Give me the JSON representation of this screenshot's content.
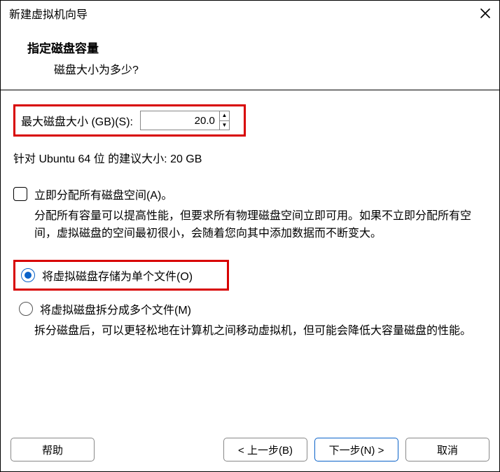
{
  "window": {
    "title": "新建虚拟机向导"
  },
  "header": {
    "title": "指定磁盘容量",
    "subtitle": "磁盘大小为多少?"
  },
  "disk": {
    "size_label": "最大磁盘大小 (GB)(S):",
    "size_value": "20.0",
    "recommendation": "针对 Ubuntu 64 位 的建议大小: 20 GB"
  },
  "allocate": {
    "checkbox_label": "立即分配所有磁盘空间(A)。",
    "checkbox_checked": false,
    "description": "分配所有容量可以提高性能，但要求所有物理磁盘空间立即可用。如果不立即分配所有空间，虚拟磁盘的空间最初很小，会随着您向其中添加数据而不断变大。"
  },
  "store": {
    "option_single_label": "将虚拟磁盘存储为单个文件(O)",
    "option_split_label": "将虚拟磁盘拆分成多个文件(M)",
    "selected": "single",
    "split_description": "拆分磁盘后，可以更轻松地在计算机之间移动虚拟机，但可能会降低大容量磁盘的性能。"
  },
  "buttons": {
    "help": "帮助",
    "back": "< 上一步(B)",
    "next": "下一步(N) >",
    "cancel": "取消"
  }
}
